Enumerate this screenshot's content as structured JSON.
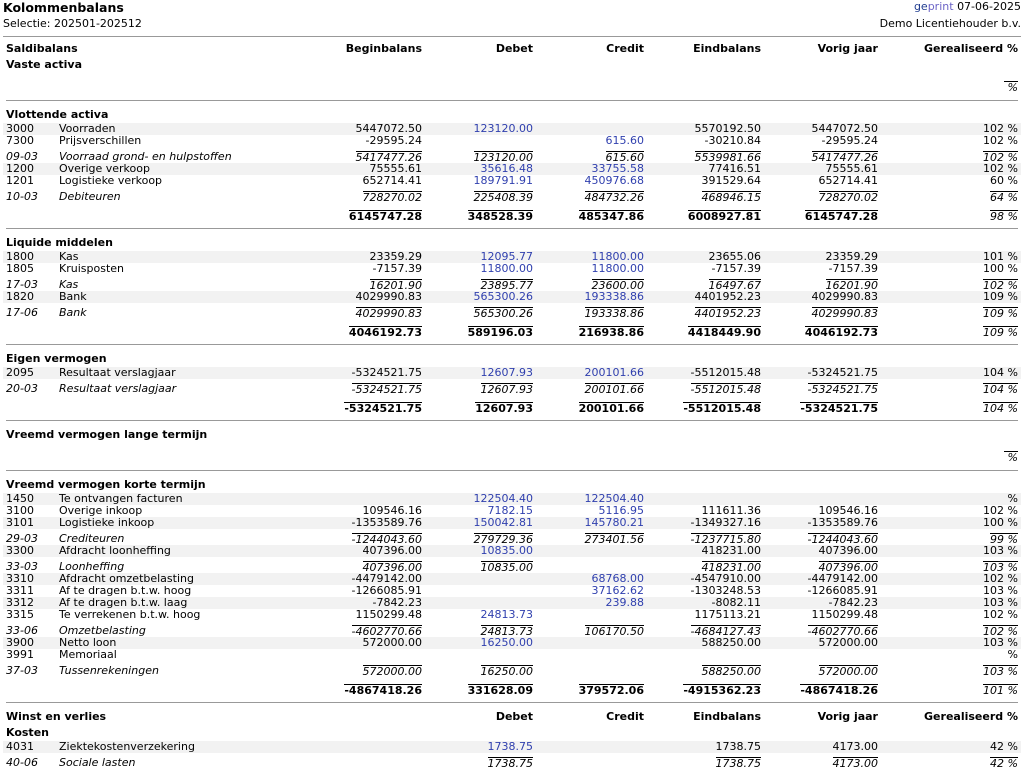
{
  "report": {
    "title": "Kolommenbalans",
    "selection": "Selectie: 202501-202512",
    "brand_ge": "ge",
    "brand_print": "print",
    "print_date": "07-06-2025",
    "organisation": "Demo Licentiehouder b.v."
  },
  "columns": {
    "name": "Saldibalans",
    "begin": "Beginbalans",
    "debet": "Debet",
    "credit": "Credit",
    "eind": "Eindbalans",
    "vorig": "Vorig jaar",
    "real": "Gerealiseerd %"
  },
  "columns2": {
    "name": "Winst en verlies",
    "debet": "Debet",
    "credit": "Credit",
    "eind": "Eindbalans",
    "vorig": "Vorig jaar",
    "real": "Gerealiseerd %"
  },
  "sections": {
    "vaste": {
      "title": "Vaste activa",
      "pct": "%"
    },
    "vlottende": {
      "title": "Vlottende activa"
    },
    "liquide": {
      "title": "Liquide middelen"
    },
    "eigen": {
      "title": "Eigen vermogen"
    },
    "lange": {
      "title": "Vreemd vermogen lange termijn",
      "pct": "%"
    },
    "korte": {
      "title": "Vreemd vermogen korte termijn"
    },
    "kosten": {
      "title": "Kosten"
    }
  },
  "rows": {
    "r3000": {
      "code": "3000",
      "name": "Voorraden",
      "begin": "5447072.50",
      "debet": "123120.00",
      "credit": "",
      "eind": "5570192.50",
      "vorig": "5447072.50",
      "pct": "102 %"
    },
    "r7300": {
      "code": "7300",
      "name": "Prijsverschillen",
      "begin": "-29595.24",
      "debet": "",
      "credit": "615.60",
      "eind": "-30210.84",
      "vorig": "-29595.24",
      "pct": "102 %"
    },
    "s0903": {
      "code": "09-03",
      "name": "Voorraad grond- en hulpstoffen",
      "begin": "5417477.26",
      "debet": "123120.00",
      "credit": "615.60",
      "eind": "5539981.66",
      "vorig": "5417477.26",
      "pct": "102 %"
    },
    "r1200": {
      "code": "1200",
      "name": "Overige verkoop",
      "begin": "75555.61",
      "debet": "35616.48",
      "credit": "33755.58",
      "eind": "77416.51",
      "vorig": "75555.61",
      "pct": "102 %"
    },
    "r1201": {
      "code": "1201",
      "name": "Logistieke verkoop",
      "begin": "652714.41",
      "debet": "189791.91",
      "credit": "450976.68",
      "eind": "391529.64",
      "vorig": "652714.41",
      "pct": "60 %"
    },
    "s1003": {
      "code": "10-03",
      "name": "Debiteuren",
      "begin": "728270.02",
      "debet": "225408.39",
      "credit": "484732.26",
      "eind": "468946.15",
      "vorig": "728270.02",
      "pct": "64 %"
    },
    "t_vlottende": {
      "begin": "6145747.28",
      "debet": "348528.39",
      "credit": "485347.86",
      "eind": "6008927.81",
      "vorig": "6145747.28",
      "pct": "98 %"
    },
    "r1800": {
      "code": "1800",
      "name": "Kas",
      "begin": "23359.29",
      "debet": "12095.77",
      "credit": "11800.00",
      "eind": "23655.06",
      "vorig": "23359.29",
      "pct": "101 %"
    },
    "r1805": {
      "code": "1805",
      "name": "Kruisposten",
      "begin": "-7157.39",
      "debet": "11800.00",
      "credit": "11800.00",
      "eind": "-7157.39",
      "vorig": "-7157.39",
      "pct": "100 %"
    },
    "s1703": {
      "code": "17-03",
      "name": "Kas",
      "begin": "16201.90",
      "debet": "23895.77",
      "credit": "23600.00",
      "eind": "16497.67",
      "vorig": "16201.90",
      "pct": "102 %"
    },
    "r1820": {
      "code": "1820",
      "name": "Bank",
      "begin": "4029990.83",
      "debet": "565300.26",
      "credit": "193338.86",
      "eind": "4401952.23",
      "vorig": "4029990.83",
      "pct": "109 %"
    },
    "s1706": {
      "code": "17-06",
      "name": "Bank",
      "begin": "4029990.83",
      "debet": "565300.26",
      "credit": "193338.86",
      "eind": "4401952.23",
      "vorig": "4029990.83",
      "pct": "109 %"
    },
    "t_liquide": {
      "begin": "4046192.73",
      "debet": "589196.03",
      "credit": "216938.86",
      "eind": "4418449.90",
      "vorig": "4046192.73",
      "pct": "109 %"
    },
    "r2095": {
      "code": "2095",
      "name": "Resultaat verslagjaar",
      "begin": "-5324521.75",
      "debet": "12607.93",
      "credit": "200101.66",
      "eind": "-5512015.48",
      "vorig": "-5324521.75",
      "pct": "104 %"
    },
    "s2003": {
      "code": "20-03",
      "name": "Resultaat verslagjaar",
      "begin": "-5324521.75",
      "debet": "12607.93",
      "credit": "200101.66",
      "eind": "-5512015.48",
      "vorig": "-5324521.75",
      "pct": "104 %"
    },
    "t_eigen": {
      "begin": "-5324521.75",
      "debet": "12607.93",
      "credit": "200101.66",
      "eind": "-5512015.48",
      "vorig": "-5324521.75",
      "pct": "104 %"
    },
    "r1450": {
      "code": "1450",
      "name": "Te ontvangen facturen",
      "begin": "",
      "debet": "122504.40",
      "credit": "122504.40",
      "eind": "",
      "vorig": "",
      "pct": "%"
    },
    "r3100": {
      "code": "3100",
      "name": "Overige inkoop",
      "begin": "109546.16",
      "debet": "7182.15",
      "credit": "5116.95",
      "eind": "111611.36",
      "vorig": "109546.16",
      "pct": "102 %"
    },
    "r3101": {
      "code": "3101",
      "name": "Logistieke inkoop",
      "begin": "-1353589.76",
      "debet": "150042.81",
      "credit": "145780.21",
      "eind": "-1349327.16",
      "vorig": "-1353589.76",
      "pct": "100 %"
    },
    "s2903": {
      "code": "29-03",
      "name": "Crediteuren",
      "begin": "-1244043.60",
      "debet": "279729.36",
      "credit": "273401.56",
      "eind": "-1237715.80",
      "vorig": "-1244043.60",
      "pct": "99 %"
    },
    "r3300": {
      "code": "3300",
      "name": "Afdracht loonheffing",
      "begin": "407396.00",
      "debet": "10835.00",
      "credit": "",
      "eind": "418231.00",
      "vorig": "407396.00",
      "pct": "103 %"
    },
    "s3303": {
      "code": "33-03",
      "name": "Loonheffing",
      "begin": "407396.00",
      "debet": "10835.00",
      "credit": "",
      "eind": "418231.00",
      "vorig": "407396.00",
      "pct": "103 %"
    },
    "r3310": {
      "code": "3310",
      "name": "Afdracht omzetbelasting",
      "begin": "-4479142.00",
      "debet": "",
      "credit": "68768.00",
      "eind": "-4547910.00",
      "vorig": "-4479142.00",
      "pct": "102 %"
    },
    "r3311": {
      "code": "3311",
      "name": "Af te dragen b.t.w. hoog",
      "begin": "-1266085.91",
      "debet": "",
      "credit": "37162.62",
      "eind": "-1303248.53",
      "vorig": "-1266085.91",
      "pct": "103 %"
    },
    "r3312": {
      "code": "3312",
      "name": "Af te dragen b.t.w. laag",
      "begin": "-7842.23",
      "debet": "",
      "credit": "239.88",
      "eind": "-8082.11",
      "vorig": "-7842.23",
      "pct": "103 %"
    },
    "r3315": {
      "code": "3315",
      "name": "Te verrekenen b.t.w. hoog",
      "begin": "1150299.48",
      "debet": "24813.73",
      "credit": "",
      "eind": "1175113.21",
      "vorig": "1150299.48",
      "pct": "102 %"
    },
    "s3306": {
      "code": "33-06",
      "name": "Omzetbelasting",
      "begin": "-4602770.66",
      "debet": "24813.73",
      "credit": "106170.50",
      "eind": "-4684127.43",
      "vorig": "-4602770.66",
      "pct": "102 %"
    },
    "r3900": {
      "code": "3900",
      "name": "Netto loon",
      "begin": "572000.00",
      "debet": "16250.00",
      "credit": "",
      "eind": "588250.00",
      "vorig": "572000.00",
      "pct": "103 %"
    },
    "r3991": {
      "code": "3991",
      "name": "Memoriaal",
      "begin": "",
      "debet": "",
      "credit": "",
      "eind": "",
      "vorig": "",
      "pct": "%"
    },
    "s3703": {
      "code": "37-03",
      "name": "Tussenrekeningen",
      "begin": "572000.00",
      "debet": "16250.00",
      "credit": "",
      "eind": "588250.00",
      "vorig": "572000.00",
      "pct": "103 %"
    },
    "t_korte": {
      "begin": "-4867418.26",
      "debet": "331628.09",
      "credit": "379572.06",
      "eind": "-4915362.23",
      "vorig": "-4867418.26",
      "pct": "101 %"
    },
    "r4031": {
      "code": "4031",
      "name": "Ziektekostenverzekering",
      "begin": "",
      "debet": "1738.75",
      "credit": "",
      "eind": "1738.75",
      "vorig": "4173.00",
      "pct": "42 %"
    },
    "s4006": {
      "code": "40-06",
      "name": "Sociale lasten",
      "begin": "",
      "debet": "1738.75",
      "credit": "",
      "eind": "1738.75",
      "vorig": "4173.00",
      "pct": "42 %"
    }
  }
}
